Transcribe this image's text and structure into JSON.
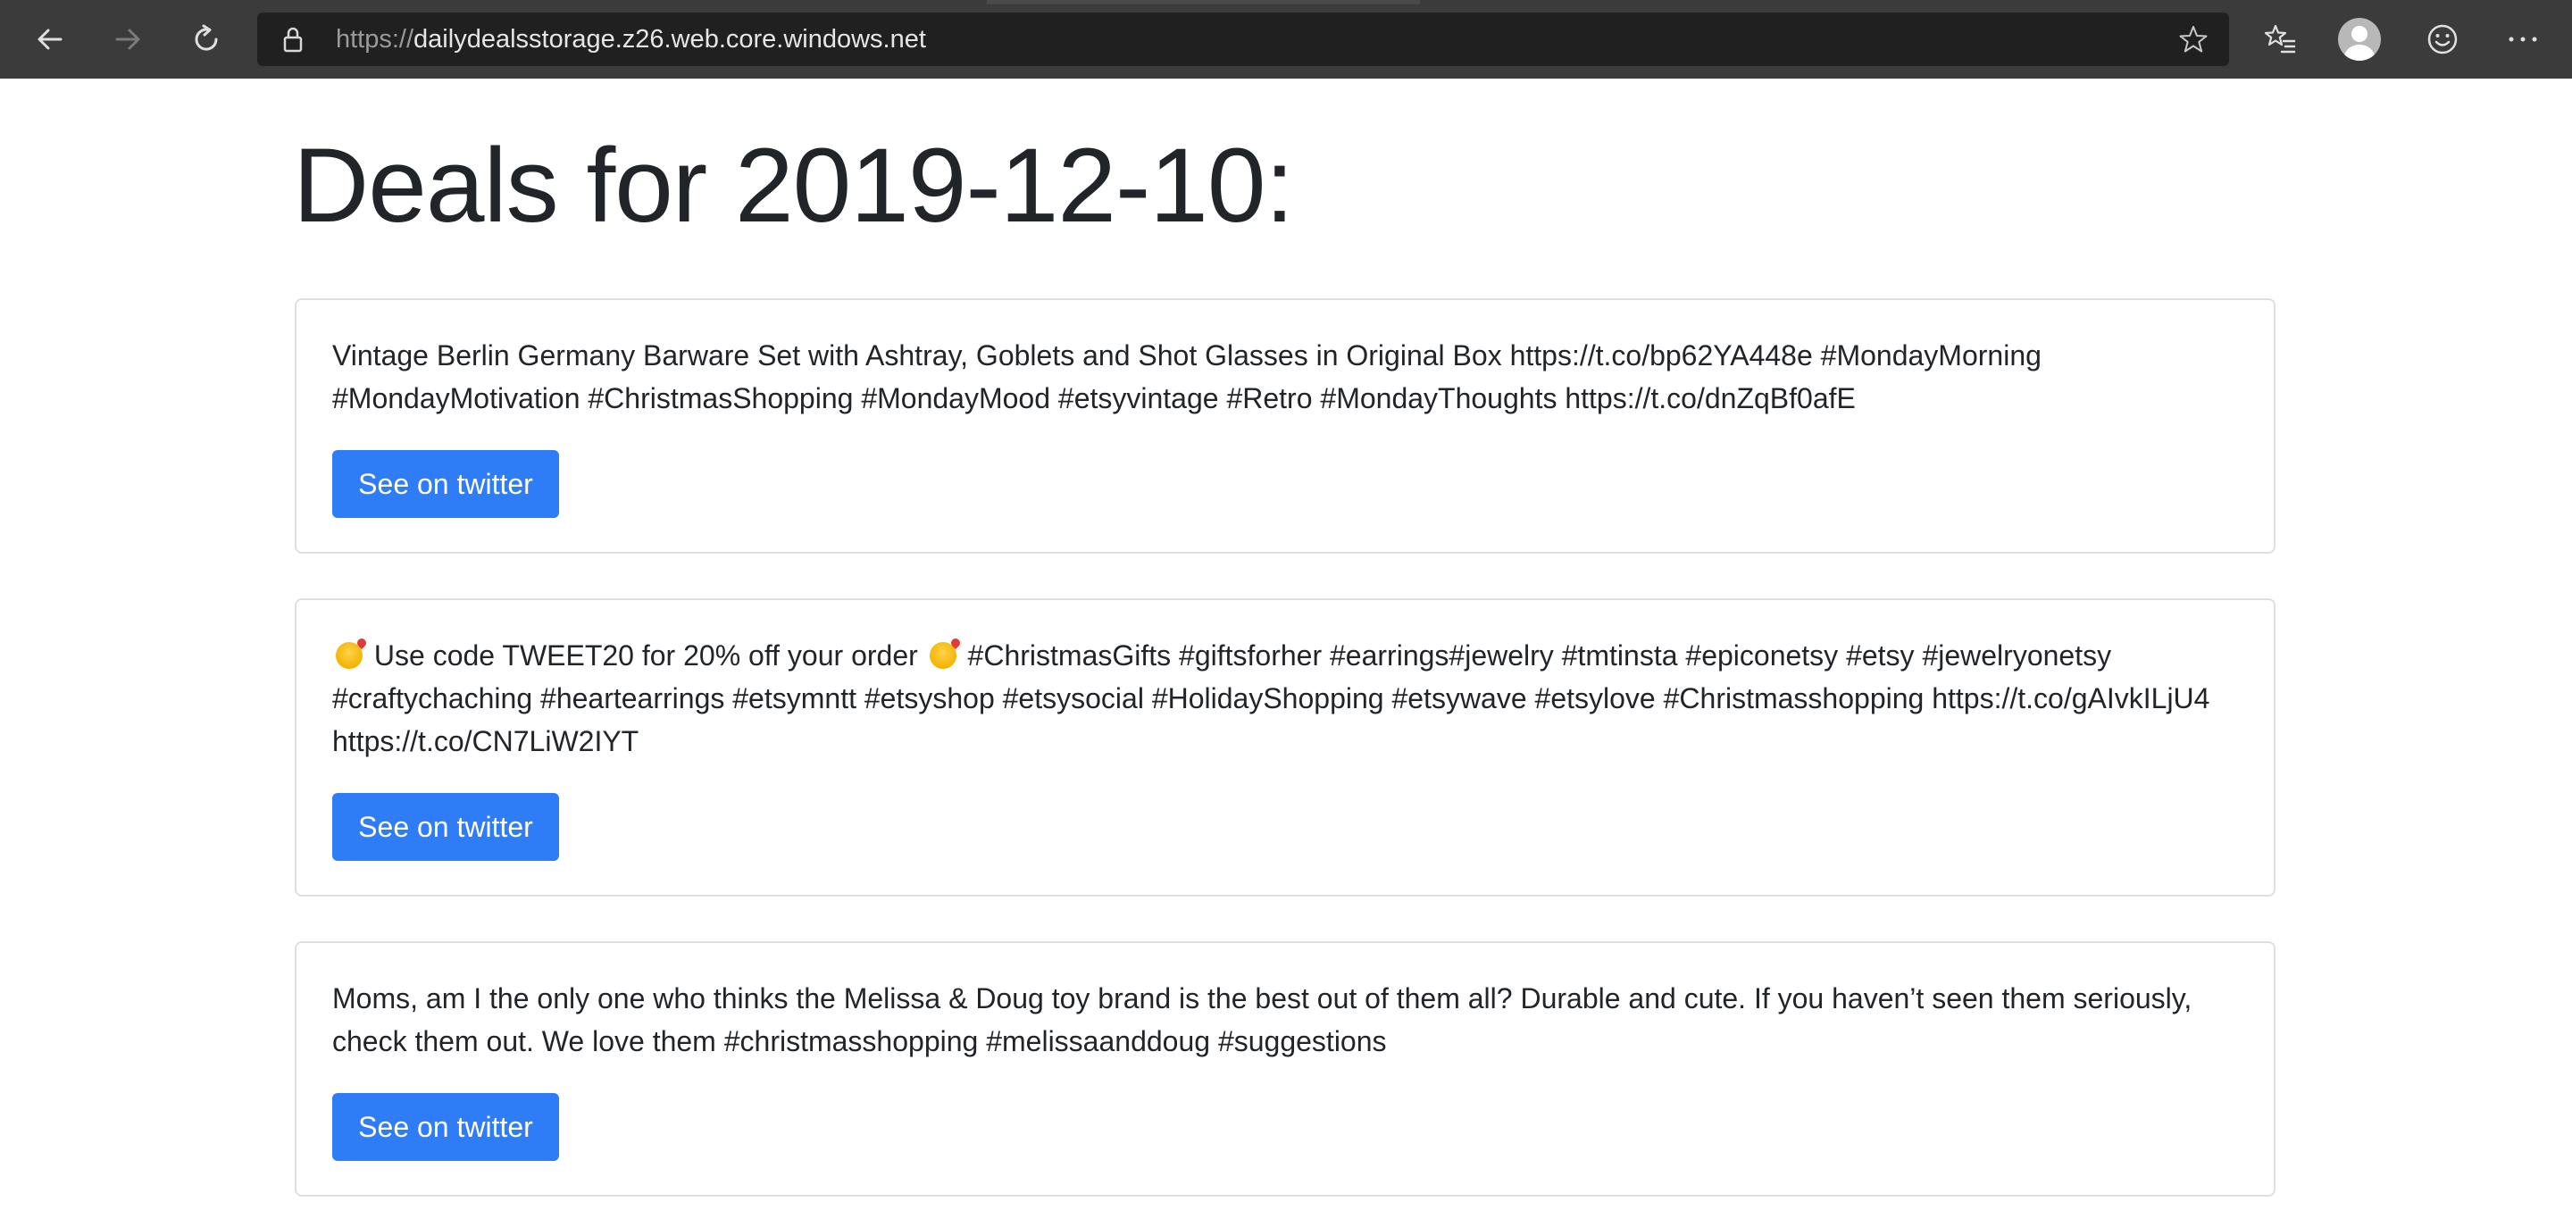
{
  "browser": {
    "url_scheme": "https://",
    "url_host": "dailydealsstorage.z26.web.core.windows.net"
  },
  "page": {
    "title": "Deals for 2019-12-10:"
  },
  "deals": [
    {
      "text": "Vintage Berlin Germany Barware Set with Ashtray, Goblets and Shot Glasses in Original Box https://t.co/bp62YA448e #MondayMorning #MondayMotivation #ChristmasShopping #MondayMood #etsyvintage #Retro #MondayThoughts https://t.co/dnZqBf0afE",
      "button_label": "See on twitter"
    },
    {
      "text_part1": "Use code TWEET20 for 20% off your order",
      "text_part2": "#ChristmasGifts #giftsforher #earrings#jewelry #tmtinsta #epiconetsy #etsy #jewelryonetsy #craftychaching #heartearrings #etsymntt #etsyshop #etsysocial #HolidayShopping #etsywave #etsylove #Christmasshopping https://t.co/gAIvkILjU4 https://t.co/CN7LiW2IYT",
      "emoji_icon": "smiling-face-with-hearts-emoji",
      "button_label": "See on twitter"
    },
    {
      "text": "Moms, am I the only one who thinks the Melissa & Doug toy brand is the best out of them all? Durable and cute. If you haven’t seen them seriously, check them out. We love them #christmasshopping #melissaanddoug #suggestions",
      "button_label": "See on twitter"
    }
  ],
  "colors": {
    "button_blue": "#2f7df6",
    "toolbar": "#3b3b3b",
    "address_bar": "#202020",
    "text": "#212529",
    "card_border": "#dfdfdf"
  }
}
